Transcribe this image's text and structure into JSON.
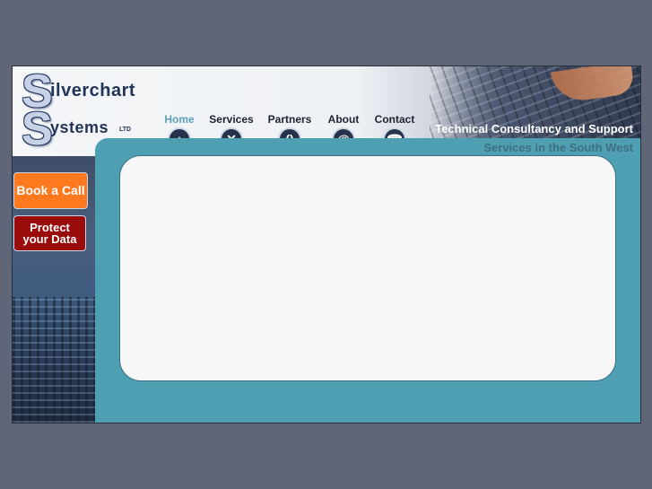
{
  "logo": {
    "letter_top": "S",
    "letter_bottom": "S",
    "word_top": "ilverchart",
    "word_bottom": "ystems",
    "suffix": "LTD"
  },
  "nav": {
    "items": [
      {
        "label": "Home",
        "icon": "home-icon",
        "glyph": "⌂",
        "active": true
      },
      {
        "label": "Services",
        "icon": "tools-icon",
        "glyph": "✕",
        "active": false
      },
      {
        "label": "Partners",
        "icon": "partners-icon",
        "glyph": "()",
        "active": false
      },
      {
        "label": "About",
        "icon": "at-icon",
        "glyph": "@",
        "active": false
      },
      {
        "label": "Contact",
        "icon": "phone-icon",
        "glyph": "☎",
        "active": false
      }
    ]
  },
  "header": {
    "tagline": "Technical Consultancy and Support",
    "subtagline": "Services in the South West"
  },
  "sidebar": {
    "call_button": "Book a Call",
    "protect_button": "Protect your Data"
  },
  "colors": {
    "page_bg": "#5f6677",
    "teal": "#4f9fb3",
    "nav_active": "#5fa0b7",
    "call_button": "#ff7a1f",
    "protect_button": "#9a0b0b"
  }
}
